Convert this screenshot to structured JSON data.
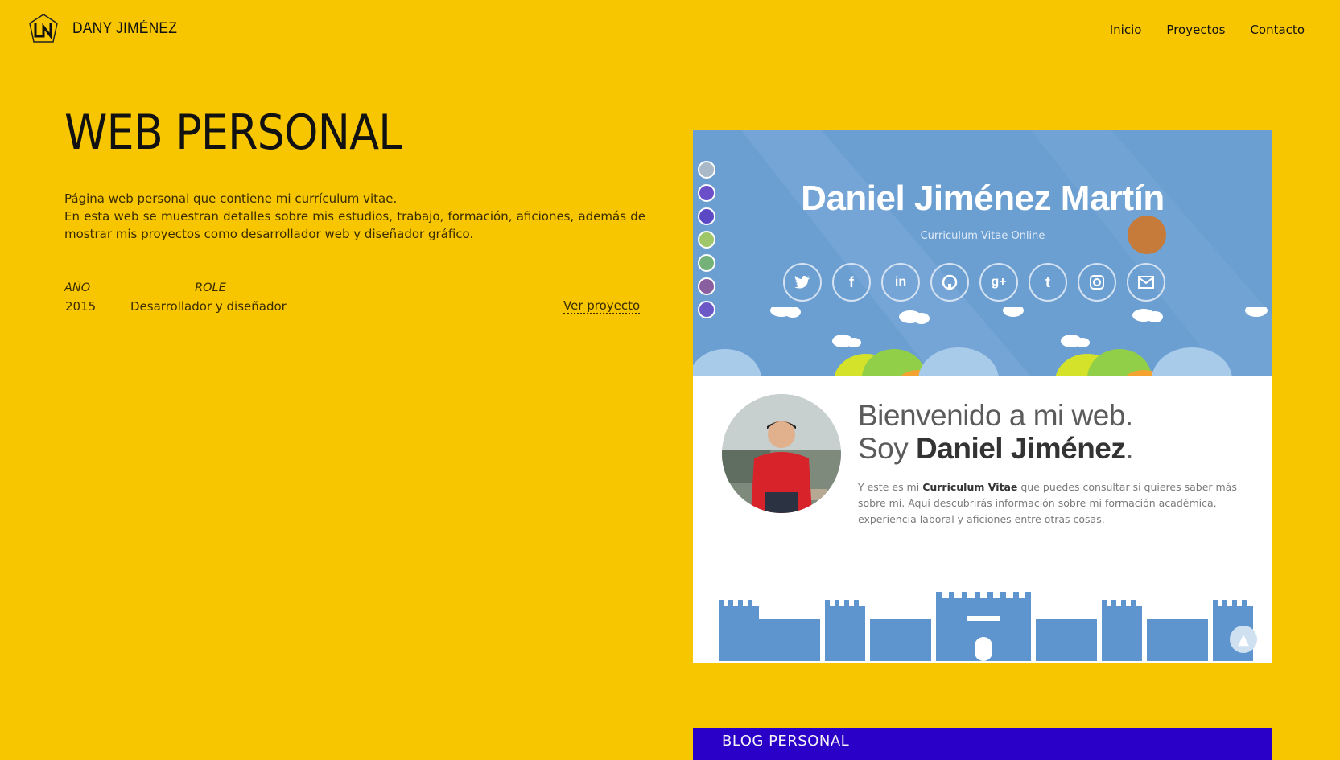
{
  "header": {
    "brand": "DANY JIMÉNEZ",
    "nav": [
      "Inicio",
      "Proyectos",
      "Contacto"
    ]
  },
  "project": {
    "title": "WEB PERSONAL",
    "description_1": "Página web personal que contiene mi currículum vitae.",
    "description_2": "En esta web se muestran detalles sobre mis estudios, trabajo, formación, aficiones, además de mostrar mis proyectos como desarrollador web y diseñador gráfico.",
    "labels": {
      "year": "AÑO",
      "role": "ROLE"
    },
    "year": "2015",
    "role": "Desarrollador y diseñador",
    "view_link": "Ver proyecto"
  },
  "preview": {
    "name": "Daniel Jiménez Martín",
    "subtitle": "Curriculum Vitae Online",
    "social_icons": [
      "twitter-icon",
      "facebook-icon",
      "linkedin-icon",
      "github-icon",
      "google-plus-icon",
      "tumblr-icon",
      "instagram-icon",
      "mail-icon"
    ],
    "hello_line1": "Bienvenido a mi web.",
    "hello_line2_prefix": "Soy",
    "hello_name": "Daniel Jiménez",
    "hello_line2_suffix": ".",
    "intro_prefix": "Y este es mi",
    "intro_bold": "Curriculum Vitae",
    "intro_rest": "que puedes consultar si quieres saber más sobre mí. Aquí descubrirás información sobre mi formación académica, experiencia laboral y aficiones entre otras cosas."
  },
  "next_project": {
    "title": "BLOG PERSONAL"
  },
  "colors": {
    "background": "#f7c600",
    "preview_sky": "#6b9fd2",
    "blog_bar": "#2a00c8"
  }
}
